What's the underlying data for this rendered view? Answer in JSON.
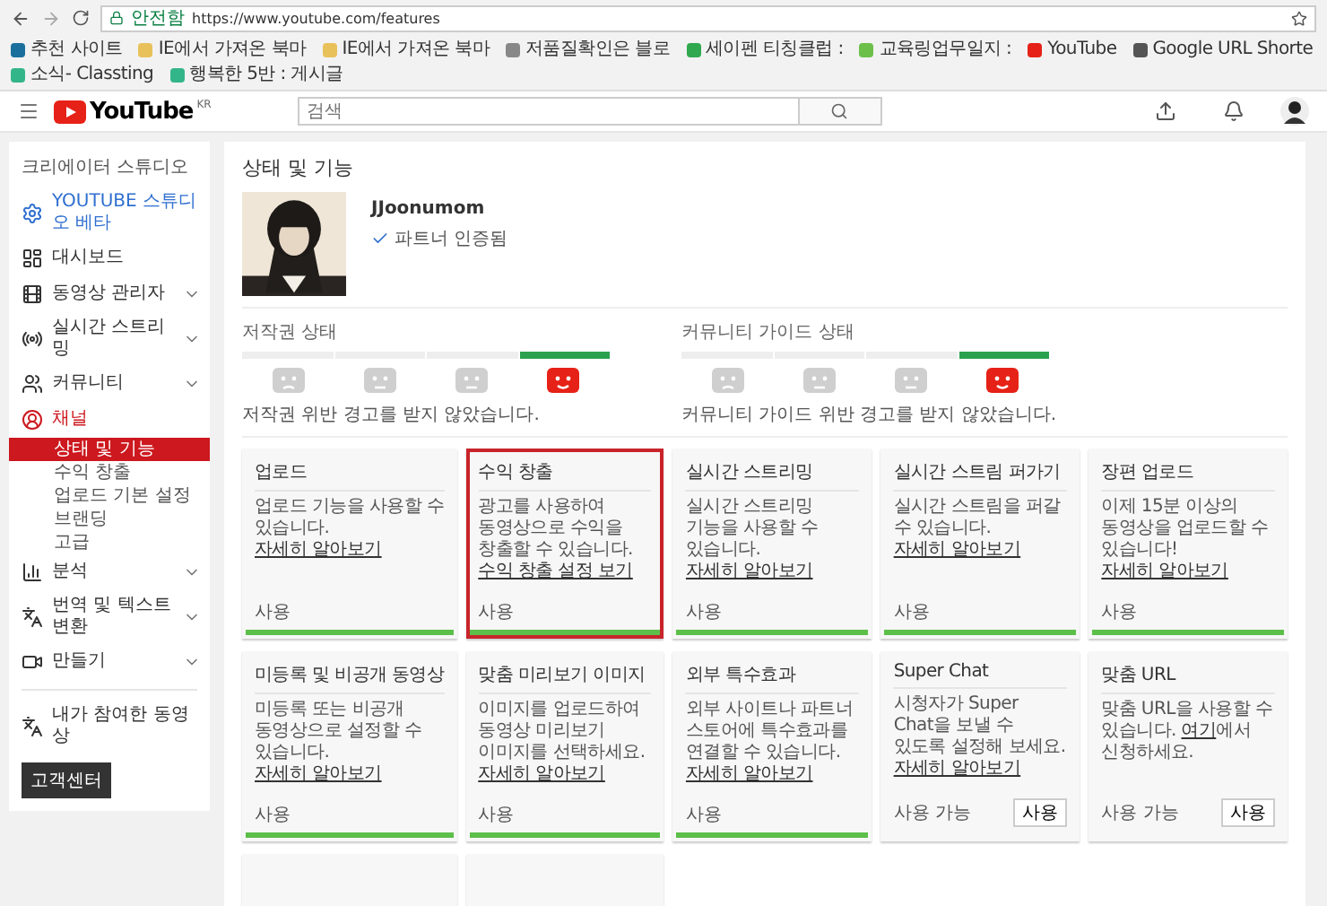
{
  "browser": {
    "secure_label": "안전함",
    "url": "https://www.youtube.com/features",
    "bookmarks": [
      {
        "label": "추천 사이트",
        "color": "#1b6f9c"
      },
      {
        "label": "IE에서 가져온 북마",
        "color": "#e8c15a"
      },
      {
        "label": "IE에서 가져온 북마",
        "color": "#e8c15a"
      },
      {
        "label": "저품질확인은 블로",
        "color": "#888888"
      },
      {
        "label": "세이펜 티칭클럽 :",
        "color": "#2fa84f"
      },
      {
        "label": "교육링업무일지 :",
        "color": "#6cc04a"
      },
      {
        "label": "YouTube",
        "color": "#e62117"
      },
      {
        "label": "Google URL Shorte",
        "color": "#555555"
      },
      {
        "label": "소식- Classting",
        "color": "#33b58a"
      },
      {
        "label": "행복한 5반 : 게시글",
        "color": "#33b58a"
      }
    ]
  },
  "header": {
    "logo": "YouTube",
    "region": "KR",
    "search": {
      "placeholder": "검색"
    }
  },
  "sidebar": {
    "title": "크리에이터 스튜디오",
    "items": [
      {
        "label": "YOUTUBE 스튜디오 베타",
        "kind": "beta",
        "expandable": false
      },
      {
        "label": "대시보드",
        "kind": "item",
        "expandable": false
      },
      {
        "label": "동영상 관리자",
        "kind": "item",
        "expandable": true
      },
      {
        "label": "실시간 스트리밍",
        "kind": "item",
        "expandable": true
      },
      {
        "label": "커뮤니티",
        "kind": "item",
        "expandable": true
      },
      {
        "label": "채널",
        "kind": "active",
        "expandable": false,
        "children": [
          {
            "label": "상태 및 기능",
            "selected": true
          },
          {
            "label": "수익 창출",
            "selected": false
          },
          {
            "label": "업로드 기본 설정",
            "selected": false
          },
          {
            "label": "브랜딩",
            "selected": false
          },
          {
            "label": "고급",
            "selected": false
          }
        ]
      },
      {
        "label": "분석",
        "kind": "item",
        "expandable": true
      },
      {
        "label": "번역 및 텍스트 변환",
        "kind": "item",
        "expandable": true
      },
      {
        "label": "만들기",
        "kind": "item",
        "expandable": true
      }
    ],
    "footer_item": {
      "label": "내가 참여한 동영상"
    },
    "help_button": "고객센터"
  },
  "page": {
    "title": "상태 및 기능",
    "channel_name": "JJoonumom",
    "verified": "파트너 인증됨",
    "statuses": [
      {
        "title": "저작권 상태",
        "faces": [
          {
            "kind": "frown",
            "selected": false
          },
          {
            "kind": "neutral",
            "selected": false
          },
          {
            "kind": "neutral",
            "selected": false
          },
          {
            "kind": "smile",
            "selected": true
          }
        ],
        "message": "저작권 위반 경고를 받지 않았습니다."
      },
      {
        "title": "커뮤니티 가이드 상태",
        "faces": [
          {
            "kind": "frown",
            "selected": false
          },
          {
            "kind": "neutral",
            "selected": false
          },
          {
            "kind": "neutral",
            "selected": false
          },
          {
            "kind": "smile",
            "selected": true
          }
        ],
        "message": "커뮤니티 가이드 위반 경고를 받지 않았습니다."
      }
    ],
    "features": [
      {
        "title": "업로드",
        "text": "업로드 기능을 사용할 수 있습니다.",
        "link": "자세히 알아보기",
        "status": "사용",
        "enabled": true,
        "selected": false
      },
      {
        "title": "수익 창출",
        "text": "광고를 사용하여 동영상으로 수익을 창출할 수 있습니다.",
        "link": "수익 창출 설정 보기",
        "status": "사용",
        "enabled": true,
        "selected": true
      },
      {
        "title": "실시간 스트리밍",
        "text": "실시간 스트리밍 기능을 사용할 수 있습니다.",
        "link": "자세히 알아보기",
        "status": "사용",
        "enabled": true,
        "selected": false
      },
      {
        "title": "실시간 스트림 퍼가기",
        "text": "실시간 스트림을 퍼갈 수 있습니다.",
        "link": "자세히 알아보기",
        "status": "사용",
        "enabled": true,
        "selected": false
      },
      {
        "title": "장편 업로드",
        "text": "이제 15분 이상의 동영상을 업로드할 수 있습니다!",
        "link": "자세히 알아보기",
        "status": "사용",
        "enabled": true,
        "selected": false
      },
      {
        "title": "미등록 및 비공개 동영상",
        "text": "미등록 또는 비공개 동영상으로 설정할 수 있습니다.",
        "link": "자세히 알아보기",
        "status": "사용",
        "enabled": true,
        "selected": false
      },
      {
        "title": "맞춤 미리보기 이미지",
        "text": "이미지를 업로드하여 동영상 미리보기 이미지를 선택하세요.",
        "link": "자세히 알아보기",
        "status": "사용",
        "enabled": true,
        "selected": false
      },
      {
        "title": "외부 특수효과",
        "text": "외부 사이트나 파트너 스토어에 특수효과를 연결할 수 있습니다.",
        "link": "자세히 알아보기",
        "status": "사용",
        "enabled": true,
        "selected": false
      },
      {
        "title": "Super Chat",
        "text": "시청자가 Super Chat을 보낼 수 있도록 설정해 보세요.",
        "link": "자세히 알아보기",
        "status": "사용 가능",
        "enabled": false,
        "button": "사용",
        "selected": false
      },
      {
        "title": "맞춤 URL",
        "text": "맞춤 URL을 사용할 수 있습니다.",
        "link": "여기",
        "after": "에서 신청하세요.",
        "status": "사용 가능",
        "enabled": false,
        "button": "사용",
        "selected": false
      }
    ]
  }
}
